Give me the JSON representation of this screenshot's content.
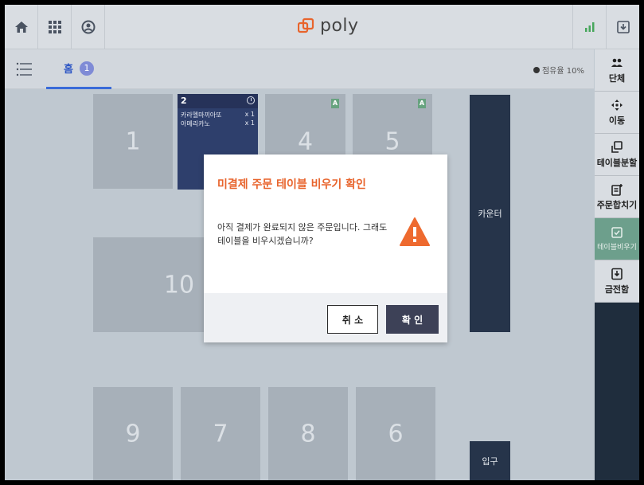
{
  "app": {
    "logo_text": "poly",
    "brand_color": "#e8642c"
  },
  "topbar": {
    "icons": [
      "home-icon",
      "grid-icon",
      "user-icon"
    ],
    "right_icons": [
      "signal-icon",
      "download-icon"
    ]
  },
  "subbar": {
    "home_tab_label": "홈",
    "home_tab_count": "1",
    "occupancy_label": "점유율 10%"
  },
  "sidebar": {
    "items": [
      {
        "label": "단체",
        "icon": "group-icon"
      },
      {
        "label": "이동",
        "icon": "move-icon"
      },
      {
        "label": "테이블분할",
        "icon": "table-split-icon"
      },
      {
        "label": "주문합치기",
        "icon": "order-merge-icon"
      },
      {
        "label": "테이블비우기",
        "icon": "clear-table-icon"
      },
      {
        "label": "금전함",
        "icon": "cash-drawer-icon"
      }
    ]
  },
  "tables": {
    "t1": "1",
    "t2": {
      "number": "2",
      "orders": [
        {
          "name": "카라멜마끼아또",
          "qty": "x 1"
        },
        {
          "name": "아메리카노",
          "qty": "x 1"
        }
      ]
    },
    "t4": "4",
    "t4_badge": "A",
    "t5": "5",
    "t5_badge": "A",
    "t10": "10",
    "t9": "9",
    "t7": "7",
    "t8": "8",
    "t6": "6",
    "counter": "카운터",
    "entrance": "입구"
  },
  "modal": {
    "title": "미결제 주문 테이블 비우기 확인",
    "message": "아직 결제가 완료되지 않은 주문입니다. 그래도 테이블을 비우시겠습니까?",
    "cancel_label": "취 소",
    "ok_label": "확 인"
  }
}
